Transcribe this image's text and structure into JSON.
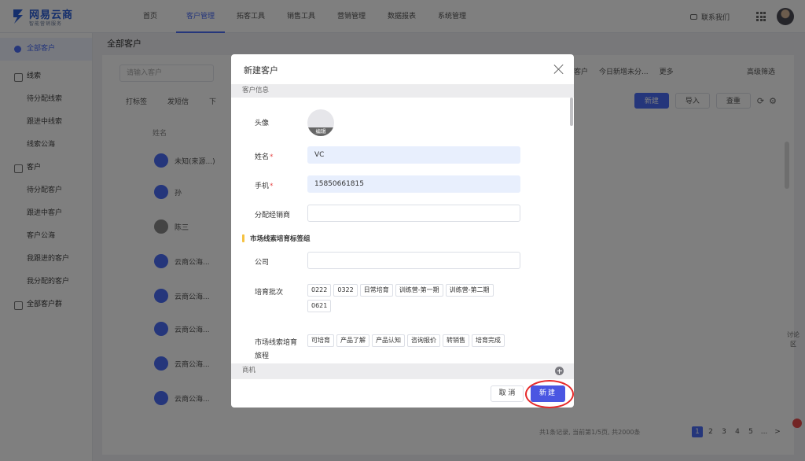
{
  "app": {
    "brand": "网易云商",
    "brand_sub": "智能营销服务"
  },
  "topnav": {
    "items": [
      {
        "label": "首页"
      },
      {
        "label": "客户管理",
        "active": true
      },
      {
        "label": "拓客工具"
      },
      {
        "label": "销售工具"
      },
      {
        "label": "营销管理"
      },
      {
        "label": "数据报表"
      },
      {
        "label": "系统管理"
      }
    ],
    "contact": "联系我们"
  },
  "sidebar": {
    "items": [
      {
        "label": "全部客户",
        "kind": "active"
      },
      {
        "label": "线索",
        "kind": "group"
      },
      {
        "label": "待分配线索",
        "kind": "sub"
      },
      {
        "label": "跟进中线索",
        "kind": "sub"
      },
      {
        "label": "线索公海",
        "kind": "sub"
      },
      {
        "label": "客户",
        "kind": "group"
      },
      {
        "label": "待分配客户",
        "kind": "sub"
      },
      {
        "label": "跟进中客户",
        "kind": "sub"
      },
      {
        "label": "客户公海",
        "kind": "sub"
      },
      {
        "label": "我跟进的客户",
        "kind": "sub"
      },
      {
        "label": "我分配的客户",
        "kind": "sub"
      },
      {
        "label": "全部客户群",
        "kind": "group"
      }
    ]
  },
  "main": {
    "title": "全部客户",
    "search_placeholder": "请输入客户",
    "tabs": [
      "打标签",
      "发短信",
      "下"
    ],
    "filters": [
      "客户",
      "今日新增未分..."
    ],
    "more": "更多",
    "advanced": "高级筛选",
    "buttons": {
      "new": "新建",
      "import": "导入",
      "check": "查重"
    },
    "column_name": "姓名",
    "rows": [
      "未知(来源...)",
      "孙",
      "陈三",
      "云商公海...",
      "云商公海...",
      "云商公海...",
      "云商公海...",
      "云商公海..."
    ],
    "total": "共1条记录, 当前第1/5页, 共2000条",
    "pages": [
      "1",
      "2",
      "3",
      "4",
      "5",
      "...",
      ">"
    ],
    "right_tools": "讨论区"
  },
  "dialog": {
    "title": "新建客户",
    "section_customer": "客户信息",
    "avatar_label": "头像",
    "avatar_edit": "编辑",
    "name_label": "姓名",
    "name_value": "VC",
    "phone_label": "手机",
    "phone_value": "15850661815",
    "dealer_label": "分配经销商",
    "dealer_value": "",
    "tag_group_title": "市场线索培育标签组",
    "company_label": "公司",
    "company_value": "",
    "batch_label": "培育批次",
    "batch_tags": [
      "0222",
      "0322",
      "日常培育",
      "训练营-第一期",
      "训练营-第二期",
      "0621"
    ],
    "journey_label": "市场线索培育",
    "journey_label_cont": "旅程",
    "journey_tags": [
      "可培育",
      "产品了解",
      "产品认知",
      "咨询报价",
      "转销售",
      "培育完成"
    ],
    "section_opportunity": "商机",
    "cancel_label": "取 消",
    "create_label": "新建"
  },
  "colors": {
    "accent": "#4a56e2",
    "required": "#e64b4b",
    "highlight": "#e62a2a"
  }
}
